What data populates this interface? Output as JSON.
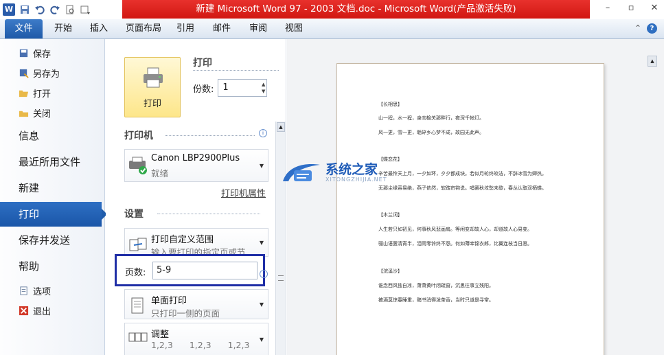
{
  "window": {
    "title": "新建 Microsoft Word 97 - 2003 文档.doc - Microsoft Word(产品激活失败)"
  },
  "ribbon": {
    "tabs": [
      "文件",
      "开始",
      "插入",
      "页面布局",
      "引用",
      "邮件",
      "审阅",
      "视图"
    ]
  },
  "nav": {
    "small_items": [
      "保存",
      "另存为",
      "打开",
      "关闭"
    ],
    "big_items": [
      "信息",
      "最近所用文件",
      "新建",
      "打印",
      "保存并发送",
      "帮助"
    ],
    "bottom_items": [
      "选项",
      "退出"
    ],
    "active": "打印"
  },
  "print": {
    "button_label": "打印",
    "section_title": "打印",
    "copies_label": "份数:",
    "copies_value": "1",
    "printer_section": "打印机",
    "printer_name": "Canon LBP2900Plus",
    "printer_status": "就绪",
    "printer_props": "打印机属性",
    "settings_section": "设置",
    "range_title": "打印自定义范围",
    "range_desc": "输入要打印的指定页或节",
    "pages_label": "页数:",
    "pages_value": "5-9",
    "sides_title": "单面打印",
    "sides_desc": "只打印一侧的页面",
    "collate_title": "调整",
    "collate_nums": [
      "1,2,3",
      "1,2,3",
      "1,2,3"
    ]
  },
  "preview": {
    "lines": [
      "【长相思】",
      "山一程，水一程，身向榆关那畔行，夜深千帐灯。",
      "风一更，雪一更，聒碎乡心梦不成，故园无此声。",
      "【蝶恋花】",
      "辛苦最怜天上月，一夕如环，夕夕都成玦。若似月轮终皎洁，不辞冰雪为卿热。",
      "无那尘缘容易绝，燕子依然，软踏帘钩说。唱罢秋坟愁未歇，春丛认取双栖蝶。",
      "【木兰词】",
      "人生若只如初见，何事秋风悲画扇。等闲变却故人心，却道故人心易变。",
      "骊山语罢清宵半，泪雨零铃终不怨。何如薄幸锦衣郎，比翼连枝当日愿。",
      "【浣溪沙】",
      "谁念西风独自凉，萧萧黄叶闭疏窗，沉思往事立残阳。",
      "被酒莫惊春睡重，赌书消得泼茶香，当时只道是寻常。"
    ]
  },
  "watermark": {
    "main": "系统之家",
    "sub": "XITONGZHIJIA.NET"
  },
  "colors": {
    "title_red": "#d11712",
    "accent_blue": "#1f5cab",
    "highlight_border": "#1f2ea6"
  }
}
